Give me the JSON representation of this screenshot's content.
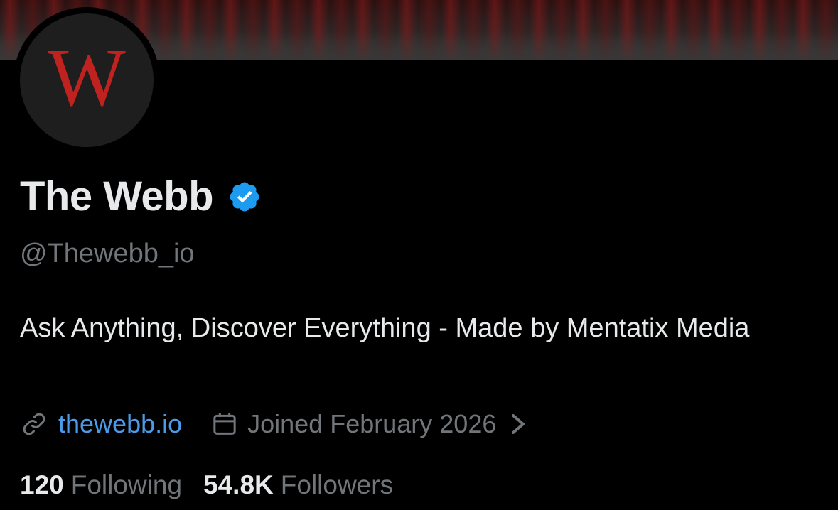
{
  "banner": {
    "icon": "banner-image"
  },
  "avatar": {
    "letter": "W",
    "letter_color": "#c0231f",
    "background": "#1e1e1e"
  },
  "profile": {
    "display_name": "The Webb",
    "verified": true,
    "verified_color": "#1d9bf0",
    "handle": "@Thewebb_io",
    "bio": "Ask Anything, Discover Everything - Made by Mentatix Media"
  },
  "meta": {
    "link_icon": "link-icon",
    "website": "thewebb.io",
    "link_color": "#4c9be8",
    "calendar_icon": "calendar-icon",
    "joined": "Joined February 2026",
    "chevron_icon": "chevron-right-icon"
  },
  "stats": {
    "following_count": "120",
    "following_label": "Following",
    "followers_count": "54.8K",
    "followers_label": "Followers"
  },
  "colors": {
    "background": "#000000",
    "primary_text": "#e7e9ea",
    "secondary_text": "#71767b"
  }
}
